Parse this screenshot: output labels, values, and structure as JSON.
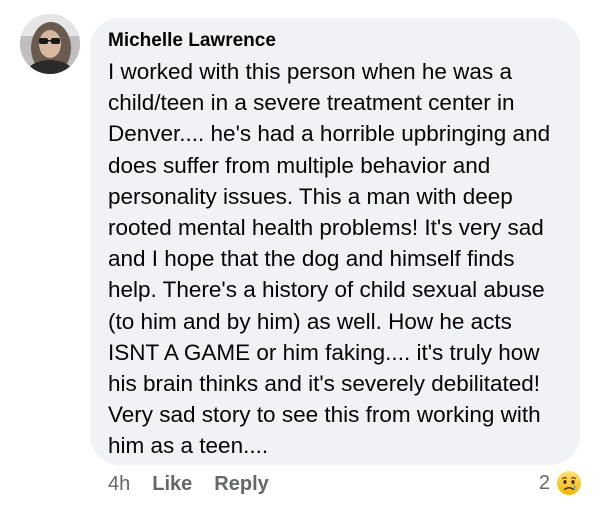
{
  "comment": {
    "author": "Michelle Lawrence",
    "text": "I worked with this person when he was a child/teen in a severe treatment center in Denver.... he's had a horrible upbringing and does suffer from multiple behavior and personality issues. This a man with deep rooted mental health problems! It's very sad and I hope that the dog and himself finds help. There's a history of child sexual abuse (to him and by him) as well. How he acts ISNT A GAME or him faking.... it's truly how his brain thinks and it's severely debilitated! Very sad story to see this from working with him as a teen....",
    "timestamp": "4h",
    "like_label": "Like",
    "reply_label": "Reply",
    "reaction_count": "2",
    "reaction_icon": "sad-face-emoji"
  }
}
